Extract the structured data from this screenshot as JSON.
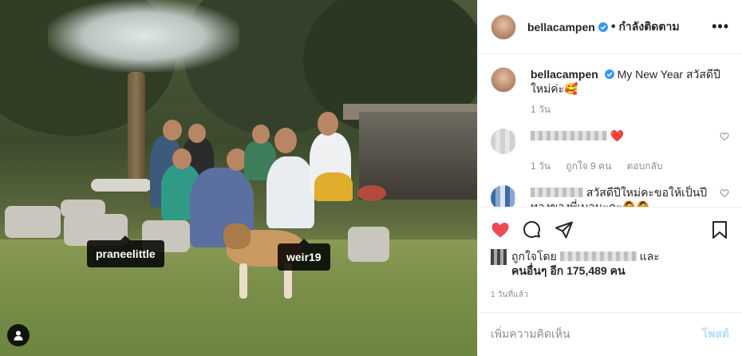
{
  "photo": {
    "tags": [
      "praneelittle",
      "weir19"
    ]
  },
  "header": {
    "username": "bellacampen",
    "separator": "•",
    "follow_status": "กำลังติดตาม",
    "more": "•••"
  },
  "caption": {
    "username": "bellacampen",
    "text": "My New Year สวัสดีปีใหม่ค่ะ🥰",
    "age": "1 วัน"
  },
  "comments": [
    {
      "text": "❤️",
      "meta": [
        "1 วัน",
        "ถูกใจ 9 คน",
        "ตอบกลับ"
      ]
    },
    {
      "text": "สวัสดีปีใหม่คะขอให้เป็นปีทองของพี่เบลนะคะ🙆🙆"
    }
  ],
  "likes": {
    "liked_by_prefix": "ถูกใจโดย",
    "and": "และ",
    "others_prefix": "คนอื่นๆ อีก",
    "count": "175,489",
    "count_unit": "คน"
  },
  "posted_ago": "1 วันที่แล้ว",
  "add_comment": {
    "placeholder": "เพิ่มความคิดเห็น",
    "post_label": "โพสต์"
  },
  "colors": {
    "like_red": "#ed4956",
    "verified_blue": "#3897f0",
    "post_disabled": "#b2dffc"
  },
  "icons": [
    "heart-icon",
    "comment-icon",
    "share-icon",
    "bookmark-icon",
    "verified-icon",
    "user-tag-icon",
    "like-comment-icon"
  ]
}
